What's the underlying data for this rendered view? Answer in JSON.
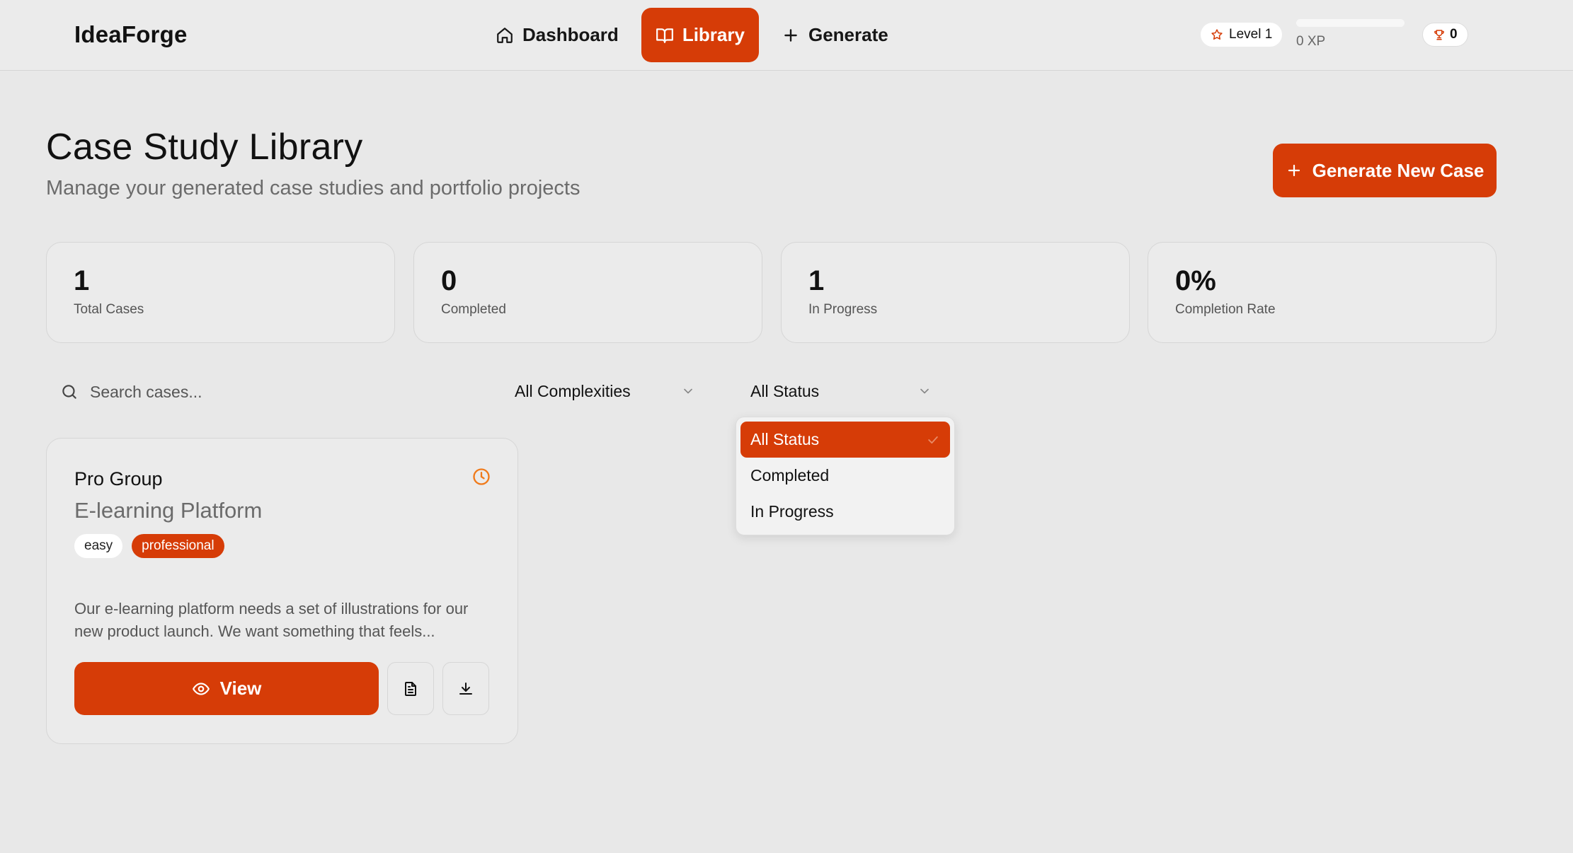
{
  "app": {
    "brand": "IdeaForge"
  },
  "nav": [
    {
      "label": "Dashboard",
      "icon": "home-icon",
      "active": false
    },
    {
      "label": "Library",
      "icon": "book-icon",
      "active": true
    },
    {
      "label": "Generate",
      "icon": "plus-icon",
      "active": false
    }
  ],
  "user": {
    "level_label": "Level 1",
    "xp_label": "0 XP",
    "xp_progress": 0,
    "trophies": "0"
  },
  "page": {
    "title": "Case Study Library",
    "subtitle": "Manage your generated case studies and portfolio projects",
    "generate_button": "Generate New Case"
  },
  "stats": [
    {
      "value": "1",
      "label": "Total Cases"
    },
    {
      "value": "0",
      "label": "Completed"
    },
    {
      "value": "1",
      "label": "In Progress"
    },
    {
      "value": "0%",
      "label": "Completion Rate"
    }
  ],
  "filters": {
    "search_placeholder": "Search cases...",
    "complexity_selected": "All Complexities",
    "status_selected": "All Status",
    "status_options": [
      "All Status",
      "Completed",
      "In Progress"
    ]
  },
  "cases": [
    {
      "client": "Pro Group",
      "industry": "E-learning Platform",
      "tags": [
        "easy",
        "professional"
      ],
      "description": "Our e-learning platform needs a set of illustrations for our new product launch. We want something that feels...",
      "view_label": "View"
    }
  ],
  "colors": {
    "accent": "#d63c07",
    "background": "#e8e8e8",
    "clock": "#f07a1a"
  }
}
